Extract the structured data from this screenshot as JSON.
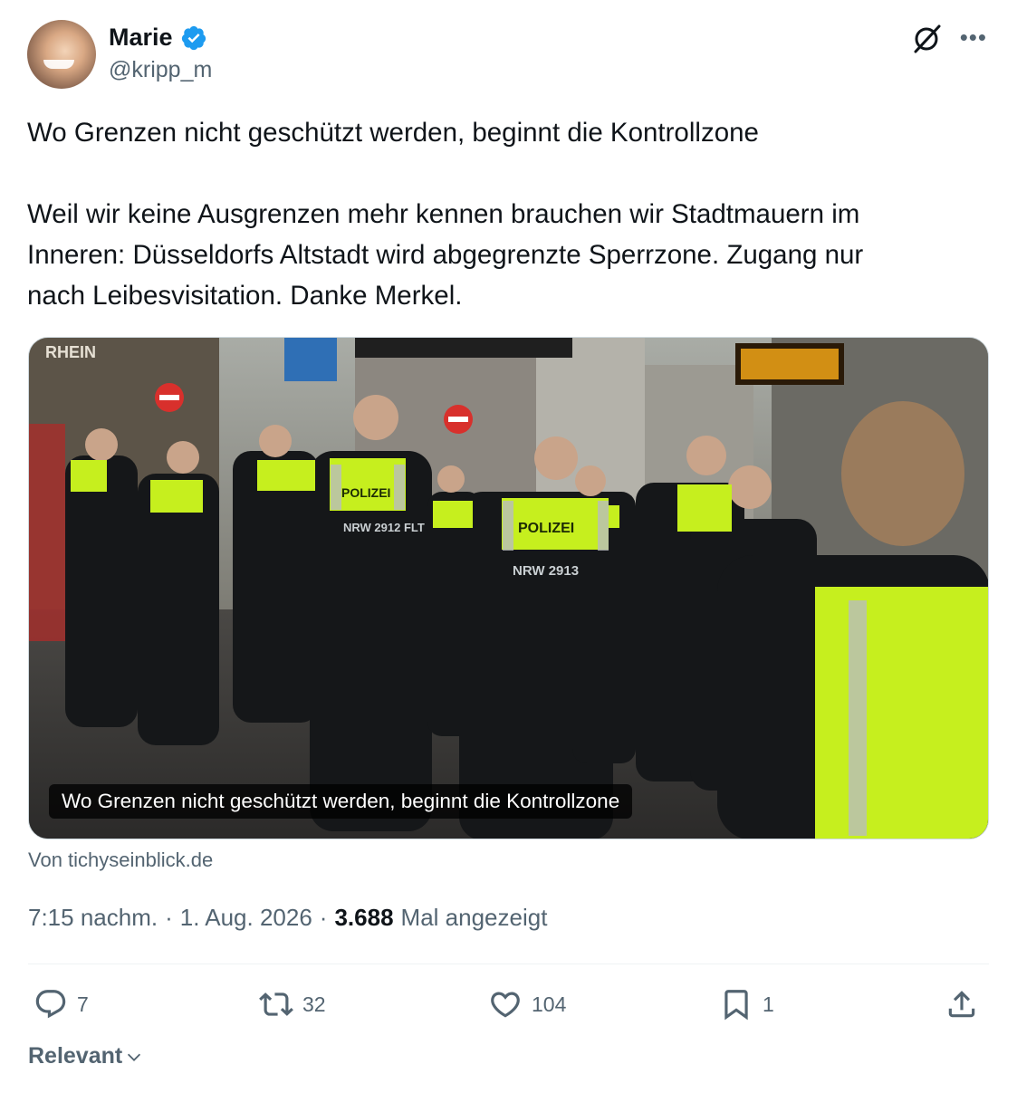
{
  "author": {
    "display_name": "Marie",
    "handle": "@kripp_m",
    "verified": true
  },
  "tweet": {
    "line1": "Wo Grenzen nicht geschützt werden, beginnt die Kontrollzone",
    "line2": "Weil wir keine Ausgrenzen mehr kennen brauchen wir Stadtmauern im",
    "line3": "Inneren: Düsseldorfs Altstadt wird abgegrenzte Sperrzone. Zugang nur",
    "line4": "nach Leibesvisitation. Danke Merkel."
  },
  "card": {
    "title": "Wo Grenzen nicht geschützt werden, beginnt die Kontrollzone",
    "source": "Von tichyseinblick.de",
    "photo_texts": {
      "shop_sign": "RHEIN",
      "vest1": "POLIZEI",
      "vest2": "NRW 2912 FLT",
      "vest3": "NRW 2913"
    }
  },
  "meta": {
    "time": "7:15 nachm.",
    "separator": "·",
    "date": "1. Aug. 2026",
    "views_count": "3.688",
    "views_label": "Mal angezeigt"
  },
  "actions": {
    "replies": "7",
    "reposts": "32",
    "likes": "104",
    "bookmarks": "1"
  },
  "sort": {
    "label": "Relevant"
  },
  "colors": {
    "verified_blue": "#1d9bf0",
    "secondary_text": "#536471",
    "primary_text": "#0f1419",
    "vest_yellow": "#c6ef1e"
  }
}
